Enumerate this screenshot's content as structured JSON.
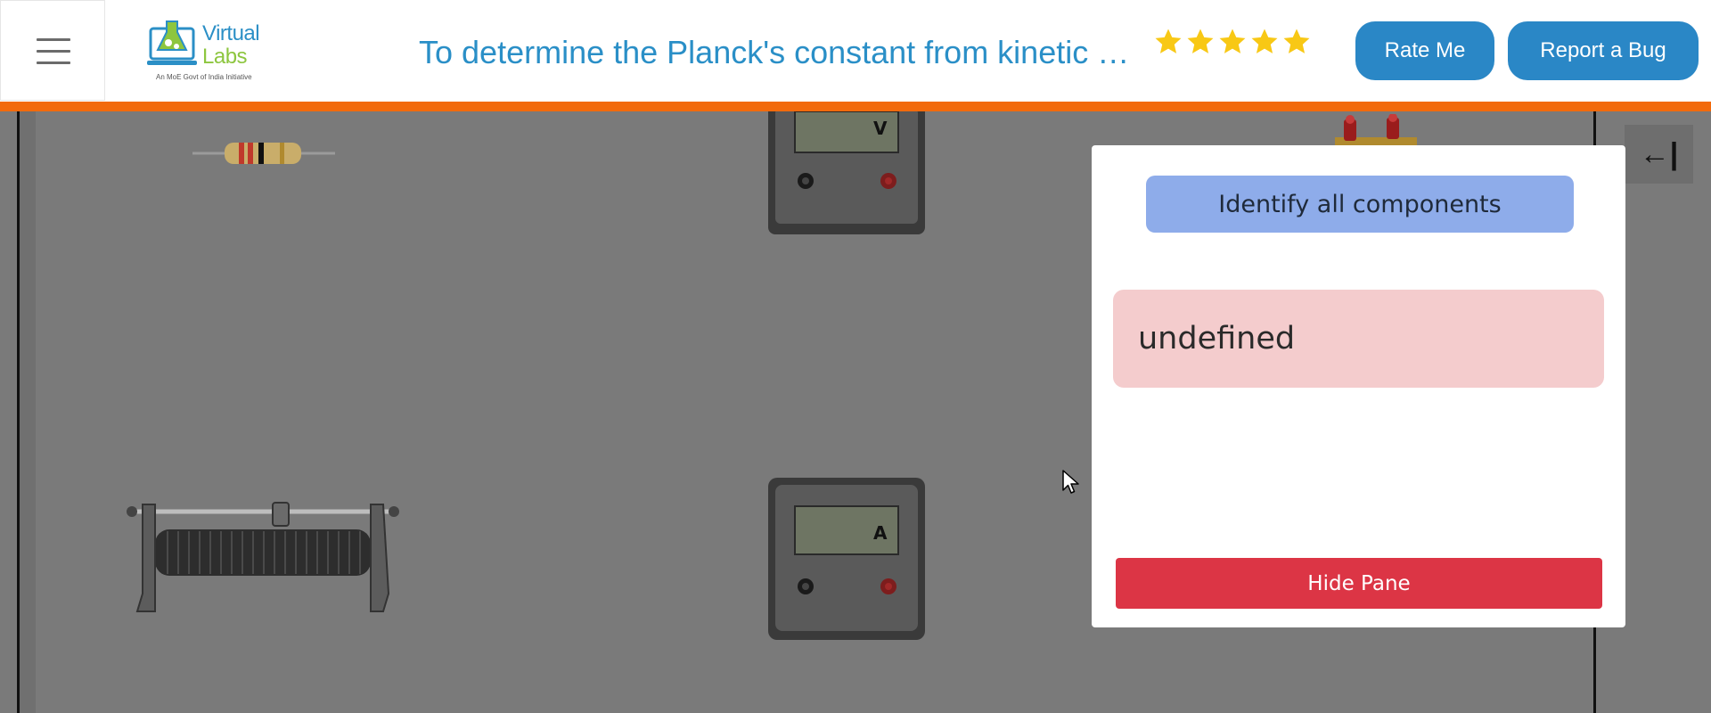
{
  "header": {
    "logo": {
      "word1": "Virtual",
      "word2": "Labs",
      "tagline": "An MoE Govt of India Initiative"
    },
    "title": "To determine the Planck's constant from kinetic energy versus frequency graph",
    "rating_stars": 5,
    "rate_button": "Rate Me",
    "bug_button": "Report a Bug"
  },
  "workspace": {
    "voltmeter_label": "V",
    "ammeter_label": "A"
  },
  "pane": {
    "identify_button": "Identify all components",
    "message": "undefined",
    "hide_button": "Hide Pane"
  },
  "side_toggle": {
    "glyph": "←|"
  },
  "colors": {
    "accent_blue": "#2a87c6",
    "orange_bar": "#f26a0c",
    "identify_bg": "#8eacea",
    "alert_bg": "#f4cccd",
    "danger": "#dc3545",
    "star": "#f8c815"
  }
}
